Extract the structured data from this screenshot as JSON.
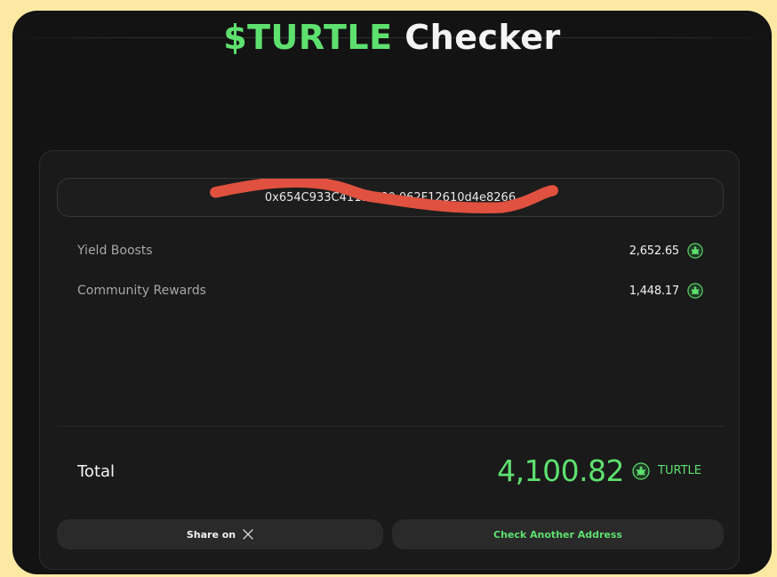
{
  "header": {
    "title_accent": "$TURTLE",
    "title_rest": "Checker"
  },
  "address": {
    "value": "0x654C933C4113fA80 062F12610d4e8266"
  },
  "breakdown": [
    {
      "label": "Yield Boosts",
      "value": "2,652.65",
      "icon": "turtle-token-icon"
    },
    {
      "label": "Community Rewards",
      "value": "1,448.17",
      "icon": "turtle-token-icon"
    }
  ],
  "total": {
    "label": "Total",
    "value": "4,100.82",
    "unit": "TURTLE"
  },
  "actions": {
    "share_label": "Share on",
    "share_icon": "x-logo-icon",
    "check_label": "Check Another Address"
  },
  "colors": {
    "accent": "#5ee06f",
    "background": "#131313",
    "card": "#1a1a1a",
    "outer": "#fde9a4",
    "redaction": "#e0513f"
  }
}
